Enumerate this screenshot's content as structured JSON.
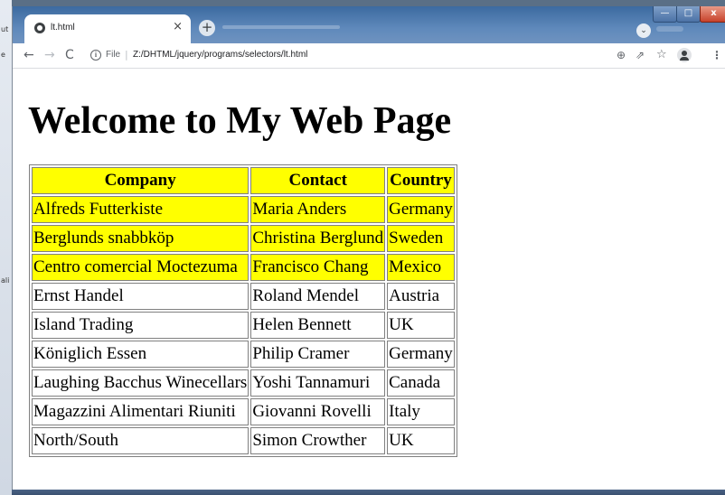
{
  "behind_window": {
    "fragments": [
      "ut",
      "e",
      "ali"
    ]
  },
  "browser": {
    "tab_title": "lt.html",
    "tab_close": "×",
    "new_tab": "+",
    "url_scheme": "File",
    "url_separator": "|",
    "url_path": "Z:/DHTML/jquery/programs/selectors/lt.html",
    "window_controls": {
      "minimize": "—",
      "maximize": "□",
      "close": "x"
    },
    "icons": {
      "back": "arrow-left-icon",
      "forward": "arrow-right-icon",
      "reload": "reload-icon",
      "info": "info-icon",
      "zoom": "zoom-icon",
      "share": "share-icon",
      "bookmark": "star-icon",
      "profile": "profile-icon",
      "menu": "kebab-menu-icon",
      "tab_search": "chevron-down-icon"
    },
    "glyphs": {
      "back": "←",
      "forward": "→",
      "reload": "C",
      "info": "i",
      "zoom": "⊕",
      "share": "⇗",
      "bookmark": "☆",
      "menu": "⋮",
      "tab_search": "⌄"
    }
  },
  "page": {
    "heading": "Welcome to My Web Page",
    "table": {
      "headers": [
        "Company",
        "Contact",
        "Country"
      ],
      "highlight_color": "#ffff00",
      "highlighted_rows": 3,
      "rows": [
        [
          "Alfreds Futterkiste",
          "Maria Anders",
          "Germany"
        ],
        [
          "Berglunds snabbköp",
          "Christina Berglund",
          "Sweden"
        ],
        [
          "Centro comercial Moctezuma",
          "Francisco Chang",
          "Mexico"
        ],
        [
          "Ernst Handel",
          "Roland Mendel",
          "Austria"
        ],
        [
          "Island Trading",
          "Helen Bennett",
          "UK"
        ],
        [
          "Königlich Essen",
          "Philip Cramer",
          "Germany"
        ],
        [
          "Laughing Bacchus Winecellars",
          "Yoshi Tannamuri",
          "Canada"
        ],
        [
          "Magazzini Alimentari Riuniti",
          "Giovanni Rovelli",
          "Italy"
        ],
        [
          "North/South",
          "Simon Crowther",
          "UK"
        ]
      ]
    }
  }
}
